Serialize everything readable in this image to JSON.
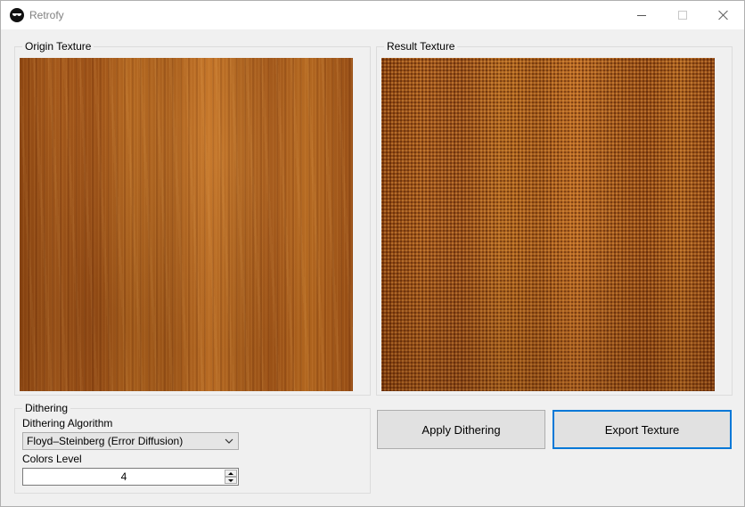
{
  "window": {
    "title": "Retrofy",
    "icon": "app-logo-icon",
    "controls": [
      "minimize-icon",
      "maximize-icon",
      "close-icon"
    ]
  },
  "origin": {
    "legend": "Origin Texture"
  },
  "result": {
    "legend": "Result Texture"
  },
  "dithering": {
    "legend": "Dithering",
    "algorithm_label": "Dithering Algorithm",
    "algorithm_value": "Floyd–Steinberg (Error Diffusion)",
    "colors_label": "Colors Level",
    "colors_value": "4"
  },
  "actions": {
    "apply_label": "Apply Dithering",
    "export_label": "Export Texture"
  },
  "colors": {
    "accent_focus": "#0078d7",
    "wood": "#a55a1c"
  }
}
